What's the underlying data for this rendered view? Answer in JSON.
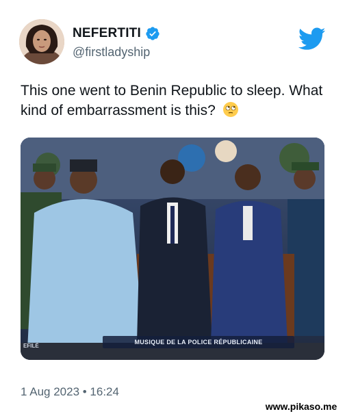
{
  "author": {
    "display_name": "NEFERTITI",
    "handle": "@firstladyship",
    "verified": true
  },
  "tweet": {
    "text": "This one went to Benin Republic to sleep. What kind of embarrassment is this?",
    "emoji": "face-with-rolling-eyes",
    "timestamp": "1 Aug 2023 • 16:24"
  },
  "media": {
    "caption": "MUSIQUE DE LA POLICE RÉPUBLICAINE",
    "side_label": "EFILÉ"
  },
  "watermark": "www.pikaso.me",
  "colors": {
    "twitter_blue": "#1d9bf0",
    "secondary_text": "#536471",
    "primary_text": "#0f1419"
  },
  "icons": [
    "verified-badge-icon",
    "twitter-bird-icon"
  ]
}
